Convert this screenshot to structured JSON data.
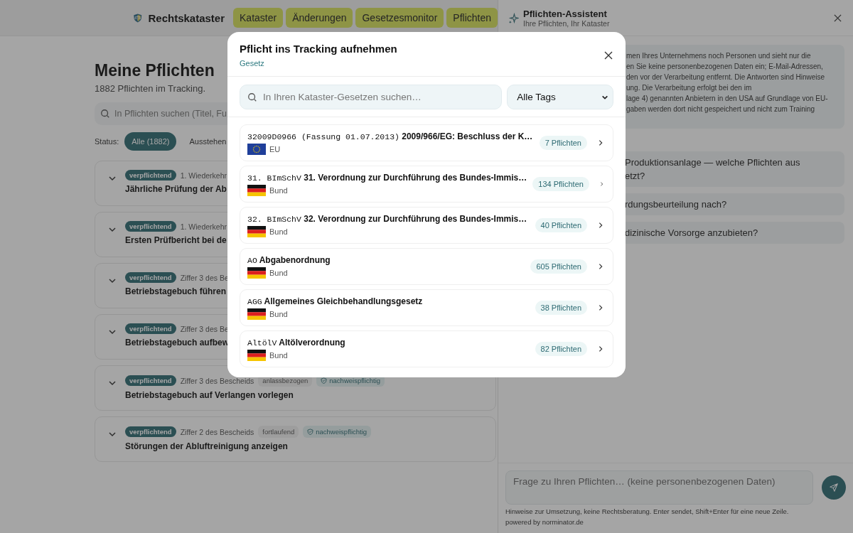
{
  "nav": {
    "brand": "Rechtskataster",
    "items": [
      {
        "label": "Kataster"
      },
      {
        "label": "Änderungen"
      },
      {
        "label": "Gesetzesmonitor"
      },
      {
        "label": "Pflichten"
      }
    ]
  },
  "page": {
    "title": "Meine Pflichten",
    "subtitle": "1882 Pflichten im Tracking.",
    "search": {
      "placeholder": "In Pflichten suchen (Titel, Fu"
    },
    "status_label": "Status:",
    "filters": [
      {
        "label": "Alle (1882)",
        "selected": true
      },
      {
        "label": "Ausstehen",
        "selected": false
      }
    ]
  },
  "obligations": [
    {
      "badge": "verpflichtend",
      "source": "1. Wiederkehr",
      "title": "Jährliche Prüfung der Ab"
    },
    {
      "badge": "verpflichtend",
      "source": "1. Wiederkehr",
      "title": "Ersten Prüfbericht bei de"
    },
    {
      "badge": "verpflichtend",
      "source": "Ziffer 3 des Be",
      "title": "Betriebstagebuch führen"
    },
    {
      "badge": "verpflichtend",
      "source": "Ziffer 3 des Be",
      "title": "Betriebstagebuch aufbew"
    },
    {
      "badge": "verpflichtend",
      "source": "Ziffer 3 des Bescheids",
      "tags": [
        {
          "label": "anlassbezogen",
          "kind": "plain"
        },
        {
          "label": "nachweispflichtig",
          "kind": "proof"
        }
      ],
      "title": "Betriebstagebuch auf Verlangen vorlegen"
    },
    {
      "badge": "verpflichtend",
      "source": "Ziffer 2 des Bescheids",
      "tags": [
        {
          "label": "fortlaufend",
          "kind": "plain"
        },
        {
          "label": "nachweispflichtig",
          "kind": "proof"
        }
      ],
      "title": "Störungen der Abluftreinigung anzeigen"
    }
  ],
  "modal": {
    "title": "Pflicht ins Tracking aufnehmen",
    "subtitle": "Gesetz",
    "search": {
      "placeholder": "In Ihren Kataster-Gesetzen suchen…"
    },
    "tag_filter": "Alle Tags",
    "laws": [
      {
        "code": "32009D0966 (Fassung 01.07.2013)",
        "name": "2009/966/EG: Beschluss der K…",
        "kind": "eu",
        "jurisdiction": "EU",
        "count": "7 Pflichten"
      },
      {
        "code": "31. BImSchV",
        "name": "31. Verordnung zur Durchführung des Bundes-Immis…",
        "kind": "de",
        "jurisdiction": "Bund",
        "count": "134 Pflichten"
      },
      {
        "code": "32. BImSchV",
        "name": "32. Verordnung zur Durchführung des Bundes-Immis…",
        "kind": "de",
        "jurisdiction": "Bund",
        "count": "40 Pflichten"
      },
      {
        "code": "AO",
        "name": "Abgabenordnung",
        "kind": "de",
        "jurisdiction": "Bund",
        "count": "605 Pflichten"
      },
      {
        "code": "AGG",
        "name": "Allgemeines Gleichbehandlungsgesetz",
        "kind": "de",
        "jurisdiction": "Bund",
        "count": "38 Pflichten"
      },
      {
        "code": "AltölV",
        "name": "Altölverordnung",
        "kind": "de",
        "jurisdiction": "Bund",
        "count": "82 Pflichten"
      }
    ]
  },
  "assistant": {
    "title": "Pflichten-Assistent",
    "subtitle": "Ihre Pflichten, Ihr Kataster",
    "notice": [
      "men Ihres Unternehmens noch Personen und sieht nur die",
      "en Sie keine personenbezogenen Daten ein; E-Mail-Adressen,",
      "den vor der Verarbeitung entfernt. Die Antworten sind Hinweise",
      "ung. Die Verarbeitung erfolgt bei den im",
      "lage 4) genannten Anbietern in den USA auf Grundlage von EU-",
      "gaben werden dort nicht gespeichert und nicht zum Training"
    ],
    "suggestions": [
      [
        "Produktionsanlage — welche Pflichten aus",
        "etzt?"
      ],
      [
        "rdungsbeurteilung nach?"
      ],
      [
        "dizinische Vorsorge anzubieten?"
      ]
    ],
    "input": {
      "placeholder": "Frage zu Ihren Pflichten… (keine personenbezogenen Daten)"
    },
    "hint": "Hinweise zur Umsetzung, keine Rechtsberatung. Enter sendet, Shift+Enter für eine neue Zeile.",
    "powered_by": "powered by norminator.de"
  }
}
